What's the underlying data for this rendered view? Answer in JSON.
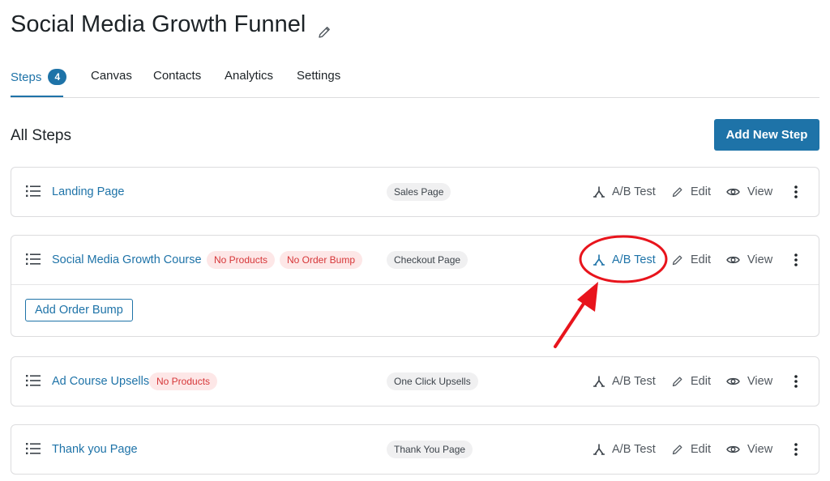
{
  "page": {
    "title": "Social Media Growth Funnel"
  },
  "tabs": [
    {
      "label": "Steps",
      "count": "4"
    },
    {
      "label": "Canvas"
    },
    {
      "label": "Contacts"
    },
    {
      "label": "Analytics"
    },
    {
      "label": "Settings"
    }
  ],
  "section": {
    "title": "All Steps",
    "add_button": "Add New Step"
  },
  "actions": {
    "ab_test": "A/B Test",
    "edit": "Edit",
    "view": "View"
  },
  "steps": [
    {
      "name": "Landing Page",
      "type": "Sales Page"
    },
    {
      "name": "Social Media Growth Course",
      "badges": [
        "No Products",
        "No Order Bump"
      ],
      "type": "Checkout Page",
      "footer_button": "Add Order Bump"
    },
    {
      "name": "Ad Course Upsells",
      "badges": [
        "No Products"
      ],
      "type": "One Click Upsells"
    },
    {
      "name": "Thank you Page",
      "type": "Thank You Page"
    }
  ],
  "colors": {
    "accent": "#1e73a8",
    "danger": "#d63638",
    "annotation": "#e8141c"
  },
  "icons": {
    "handle": "list-drag-icon",
    "ab": "split-icon",
    "edit": "pencil-icon",
    "view": "eye-icon",
    "more": "kebab-icon"
  }
}
